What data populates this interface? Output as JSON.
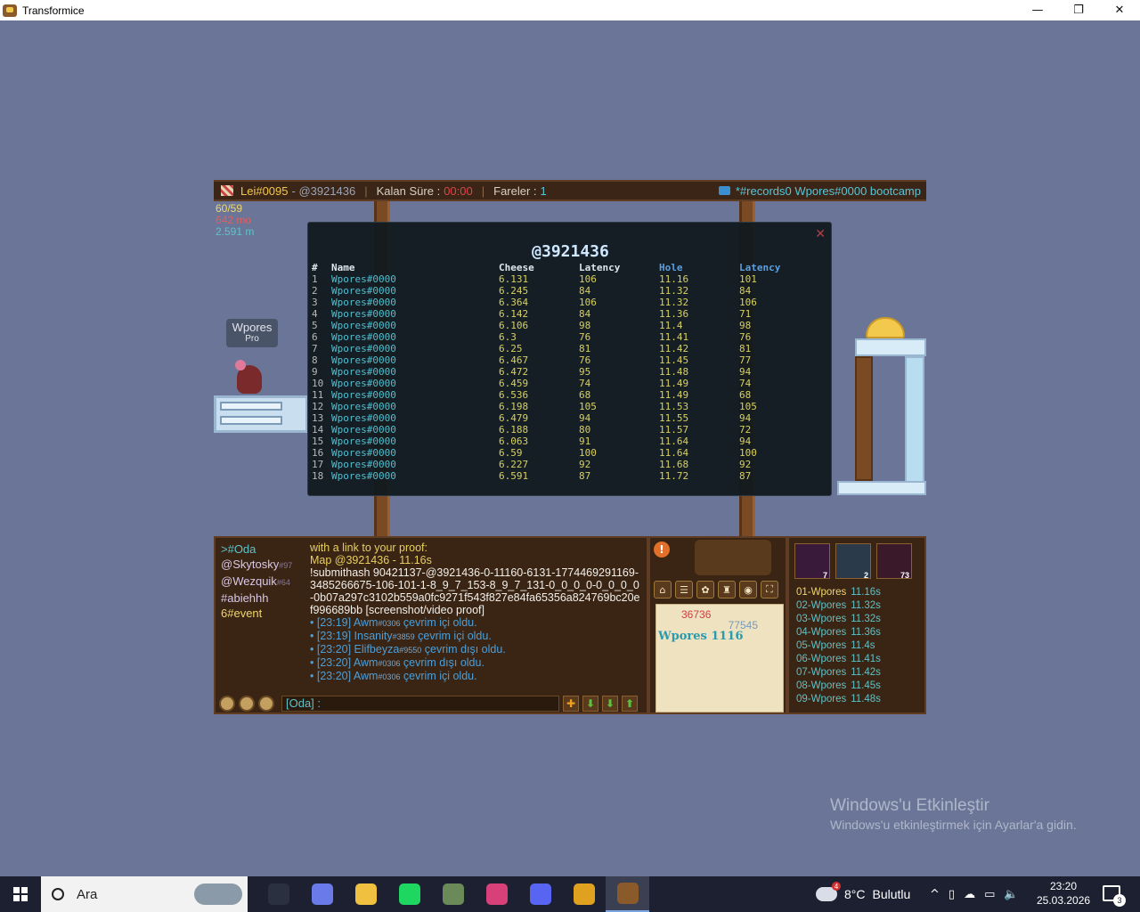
{
  "window": {
    "title": "Transformice",
    "controls": {
      "minimize": "—",
      "restore": "❐",
      "close": "✕"
    }
  },
  "game": {
    "topbar": {
      "map_owner": "Lei#0095",
      "map_code": "- @3921436",
      "time_label": "Kalan Süre :",
      "time_value": "00:00",
      "mice_label": "Fareler :",
      "mice_value": "1",
      "room": "*#records0 Wpores#0000 bootcamp"
    },
    "stats": {
      "fps": "60/59",
      "ms": "642 mo",
      "mem": "2.591 m"
    },
    "player_tag": {
      "name": "Wpores",
      "title": "Pro"
    }
  },
  "records_popup": {
    "title": "@3921436",
    "close": "✕",
    "headers": {
      "num": "#",
      "name": "Name",
      "cheese": "Cheese",
      "lat1": "Latency",
      "hole": "Hole",
      "lat2": "Latency"
    },
    "rows": [
      [
        "1",
        "Wpores#0000",
        "6.131",
        "106",
        "11.16",
        "101"
      ],
      [
        "2",
        "Wpores#0000",
        "6.245",
        "84",
        "11.32",
        "84"
      ],
      [
        "3",
        "Wpores#0000",
        "6.364",
        "106",
        "11.32",
        "106"
      ],
      [
        "4",
        "Wpores#0000",
        "6.142",
        "84",
        "11.36",
        "71"
      ],
      [
        "5",
        "Wpores#0000",
        "6.106",
        "98",
        "11.4",
        "98"
      ],
      [
        "6",
        "Wpores#0000",
        "6.3",
        "76",
        "11.41",
        "76"
      ],
      [
        "7",
        "Wpores#0000",
        "6.25",
        "81",
        "11.42",
        "81"
      ],
      [
        "8",
        "Wpores#0000",
        "6.467",
        "76",
        "11.45",
        "77"
      ],
      [
        "9",
        "Wpores#0000",
        "6.472",
        "95",
        "11.48",
        "94"
      ],
      [
        "10",
        "Wpores#0000",
        "6.459",
        "74",
        "11.49",
        "74"
      ],
      [
        "11",
        "Wpores#0000",
        "6.536",
        "68",
        "11.49",
        "68"
      ],
      [
        "12",
        "Wpores#0000",
        "6.198",
        "105",
        "11.53",
        "105"
      ],
      [
        "13",
        "Wpores#0000",
        "6.479",
        "94",
        "11.55",
        "94"
      ],
      [
        "14",
        "Wpores#0000",
        "6.188",
        "80",
        "11.57",
        "72"
      ],
      [
        "15",
        "Wpores#0000",
        "6.063",
        "91",
        "11.64",
        "94"
      ],
      [
        "16",
        "Wpores#0000",
        "6.59",
        "100",
        "11.64",
        "100"
      ],
      [
        "17",
        "Wpores#0000",
        "6.227",
        "92",
        "11.68",
        "92"
      ],
      [
        "18",
        "Wpores#0000",
        "6.591",
        "87",
        "11.72",
        "87"
      ]
    ]
  },
  "chat": {
    "channels": [
      {
        "label": ">#Oda",
        "tag": "",
        "kind": "active"
      },
      {
        "label": "@Skytosky",
        "tag": "#97",
        "kind": "ch"
      },
      {
        "label": "@Wezquik",
        "tag": "#64",
        "kind": "ch"
      },
      {
        "label": "#abiehhh",
        "tag": "",
        "kind": "ch"
      },
      {
        "label": "6#event",
        "tag": "",
        "kind": "event"
      }
    ],
    "messages": [
      {
        "kind": "y",
        "text": "with a link to your proof:"
      },
      {
        "kind": "y",
        "text": "Map @3921436 - 11.16s"
      },
      {
        "kind": "w",
        "text": "!submithash 90421137-@3921436-0-11160-6131-1774469291169-3485266675-106-101-1-8_9_7_153-8_9_7_131-0_0_0_0-0_0_0_0-0b07a297c3102b559a0fc9271f543f827e84fa65356a824769bc20ef996689bb [screenshot/video proof]"
      },
      {
        "kind": "sys",
        "pre": "• [23:19] Awm",
        "tag": "#0306",
        "post": " çevrim içi oldu."
      },
      {
        "kind": "sys",
        "pre": "• [23:19] Insanity",
        "tag": "#3859",
        "post": " çevrim içi oldu."
      },
      {
        "kind": "sys",
        "pre": "• [23:20] Elifbeyza",
        "tag": "#9550",
        "post": " çevrim dışı oldu."
      },
      {
        "kind": "sys",
        "pre": "• [23:20] Awm",
        "tag": "#0306",
        "post": " çevrim dışı oldu."
      },
      {
        "kind": "sys",
        "pre": "• [23:20] Awm",
        "tag": "#0306",
        "post": " çevrim içi oldu."
      }
    ],
    "input_value": "[Oda] :",
    "buttons": {
      "plus": "✚",
      "down1": "⬇",
      "down2": "⬇",
      "up": "⬆"
    }
  },
  "profile": {
    "alert": "!",
    "cheese_count": "36736",
    "first_count": "77545",
    "name": "Wpores",
    "level": "1116",
    "toolbar": [
      "⌂",
      "☰",
      "✿",
      "♜",
      "◉",
      "⛶"
    ]
  },
  "ranking": {
    "items": [
      {
        "count": "7",
        "color": "#3a1a3a"
      },
      {
        "count": "2",
        "color": "#2a3a4a"
      },
      {
        "count": "73",
        "color": "#3a1a2a"
      }
    ],
    "entries": [
      {
        "rank": "01-Wpores",
        "time": "11.16s"
      },
      {
        "rank": "02-Wpores",
        "time": "11.32s"
      },
      {
        "rank": "03-Wpores",
        "time": "11.32s"
      },
      {
        "rank": "04-Wpores",
        "time": "11.36s"
      },
      {
        "rank": "05-Wpores",
        "time": "11.4s"
      },
      {
        "rank": "06-Wpores",
        "time": "11.41s"
      },
      {
        "rank": "07-Wpores",
        "time": "11.42s"
      },
      {
        "rank": "08-Wpores",
        "time": "11.45s"
      },
      {
        "rank": "09-Wpores",
        "time": "11.48s"
      }
    ]
  },
  "activation": {
    "line1": "Windows'u Etkinleştir",
    "line2": "Windows'u etkinleştirmek için Ayarlar'a gidin."
  },
  "taskbar": {
    "search_placeholder": "Ara",
    "apps": [
      {
        "name": "task-view-icon",
        "color": "#2a3040"
      },
      {
        "name": "copilot-icon",
        "color": "#6a7ae8"
      },
      {
        "name": "file-explorer-icon",
        "color": "#f0c040"
      },
      {
        "name": "spotify-icon",
        "color": "#1ed760"
      },
      {
        "name": "minecraft-icon",
        "color": "#6a8a5a"
      },
      {
        "name": "instagram-icon",
        "color": "#d8407a"
      },
      {
        "name": "discord-icon",
        "color": "#5865f2"
      },
      {
        "name": "chrome-icon",
        "color": "#e0a020"
      },
      {
        "name": "transformice-icon",
        "color": "#8a5a2a"
      }
    ],
    "weather_temp": "8°C",
    "weather_desc": "Bulutlu",
    "weather_badge": "4",
    "tray_icons": [
      "^",
      "▯",
      "☁",
      "▭",
      "🔈"
    ],
    "time": "23:20",
    "date": "25.03.2026",
    "notifications": "3"
  }
}
